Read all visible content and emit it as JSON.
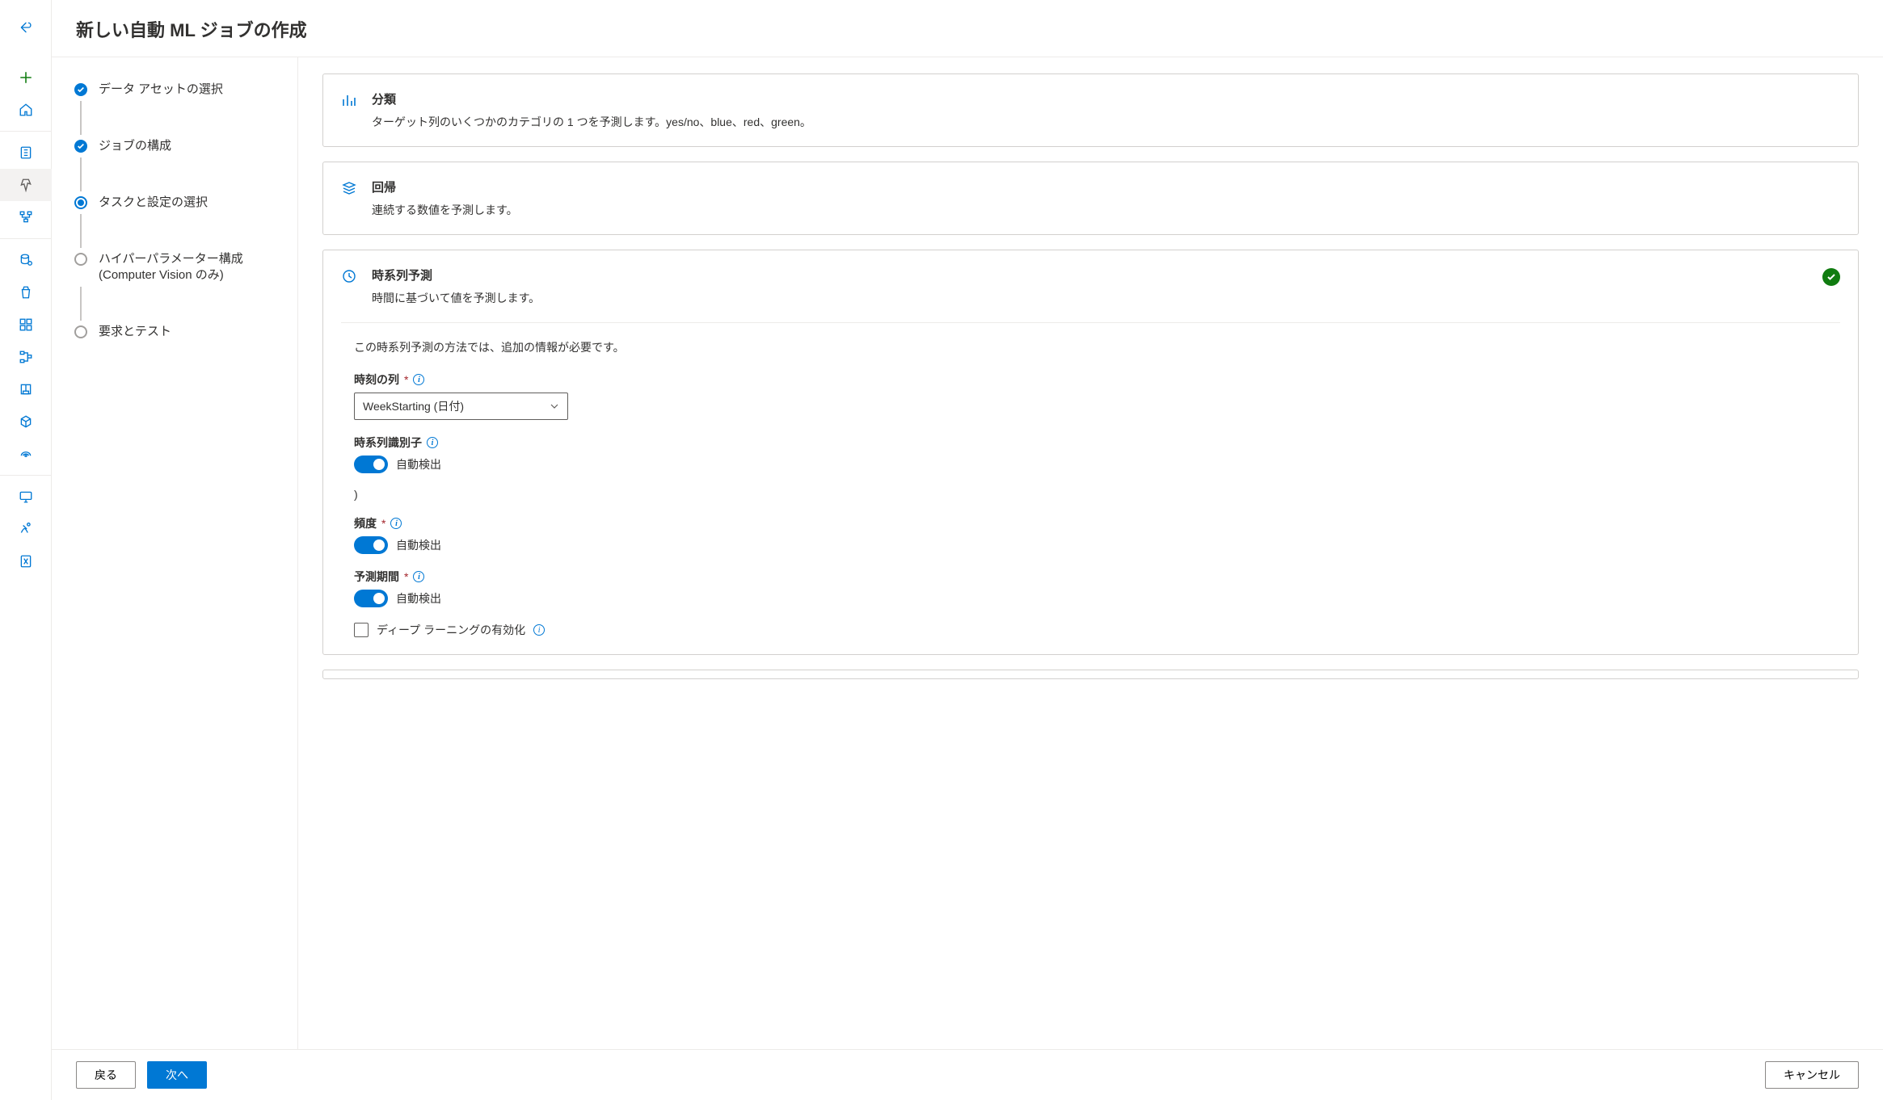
{
  "header": {
    "title": "新しい自動 ML ジョブの作成"
  },
  "stepper": {
    "steps": [
      {
        "label": "データ アセットの選択"
      },
      {
        "label": "ジョブの構成"
      },
      {
        "label": "タスクと設定の選択"
      },
      {
        "label": "ハイパーパラメーター構成 (Computer Vision のみ)"
      },
      {
        "label": "要求とテスト"
      }
    ]
  },
  "tasks": {
    "classification": {
      "title": "分類",
      "desc": "ターゲット列のいくつかのカテゴリの 1 つを予測します。yes/no、blue、red、green。"
    },
    "regression": {
      "title": "回帰",
      "desc": "連続する数値を予測します。"
    },
    "forecasting": {
      "title": "時系列予測",
      "desc": "時間に基づいて値を予測します。",
      "info_line": "この時系列予測の方法では、追加の情報が必要です。",
      "time_column": {
        "label": "時刻の列",
        "value": "WeekStarting (日付)"
      },
      "series_id": {
        "label": "時系列識別子",
        "toggle_label": "自動検出"
      },
      "stray_paren": ")",
      "frequency": {
        "label": "頻度",
        "toggle_label": "自動検出"
      },
      "horizon": {
        "label": "予測期間",
        "toggle_label": "自動検出"
      },
      "deep_learning": {
        "label": "ディープ ラーニングの有効化"
      }
    }
  },
  "footer": {
    "back": "戻る",
    "next": "次へ",
    "cancel": "キャンセル"
  }
}
